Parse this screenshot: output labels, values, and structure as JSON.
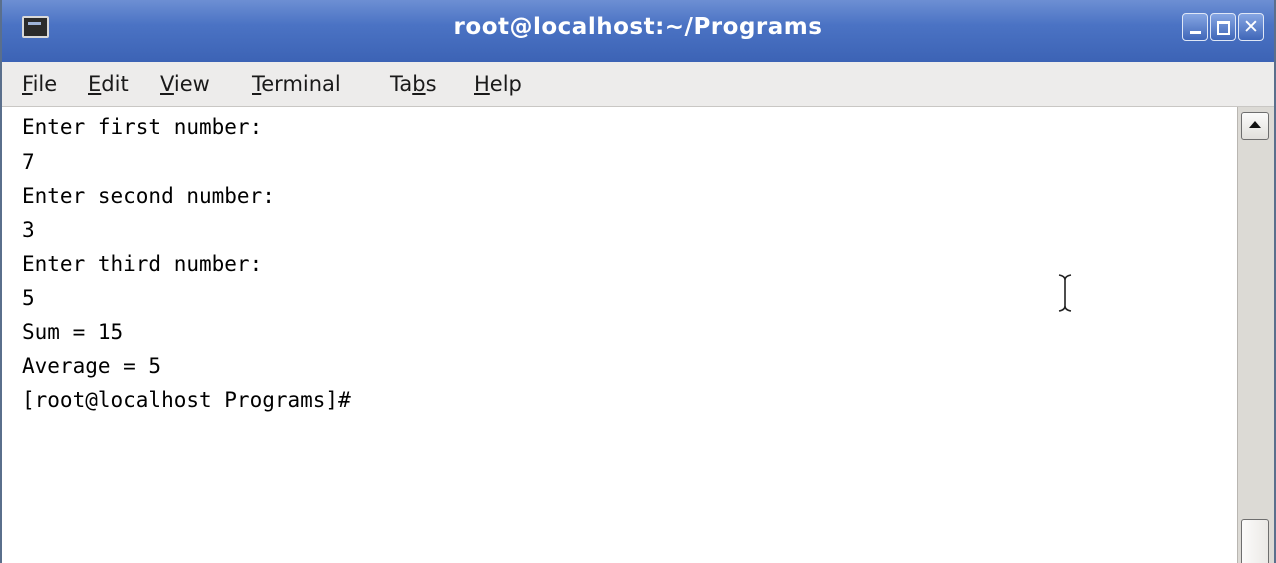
{
  "window": {
    "title": "root@localhost:~/Programs",
    "icon": "terminal-icon"
  },
  "menu": [
    {
      "label": "File",
      "mnemonic": "F",
      "rest": "ile"
    },
    {
      "label": "Edit",
      "mnemonic": "E",
      "rest": "dit"
    },
    {
      "label": "View",
      "mnemonic": "V",
      "rest": "iew"
    },
    {
      "label": "Terminal",
      "mnemonic": "T",
      "rest": "erminal"
    },
    {
      "label": "Tabs",
      "pre": "Ta",
      "mnemonic": "b",
      "rest": "s"
    },
    {
      "label": "Help",
      "mnemonic": "H",
      "rest": "elp"
    }
  ],
  "terminal": {
    "lines": [
      "Enter first number:",
      "7",
      "Enter second number:",
      "3",
      "Enter third number:",
      "5",
      "Sum = 15",
      "Average = 5",
      "[root@localhost Programs]#"
    ]
  },
  "colors": {
    "titlebar": "#4b73c4",
    "menubar": "#edeceb",
    "terminal_bg": "#ffffff",
    "terminal_fg": "#000000"
  }
}
